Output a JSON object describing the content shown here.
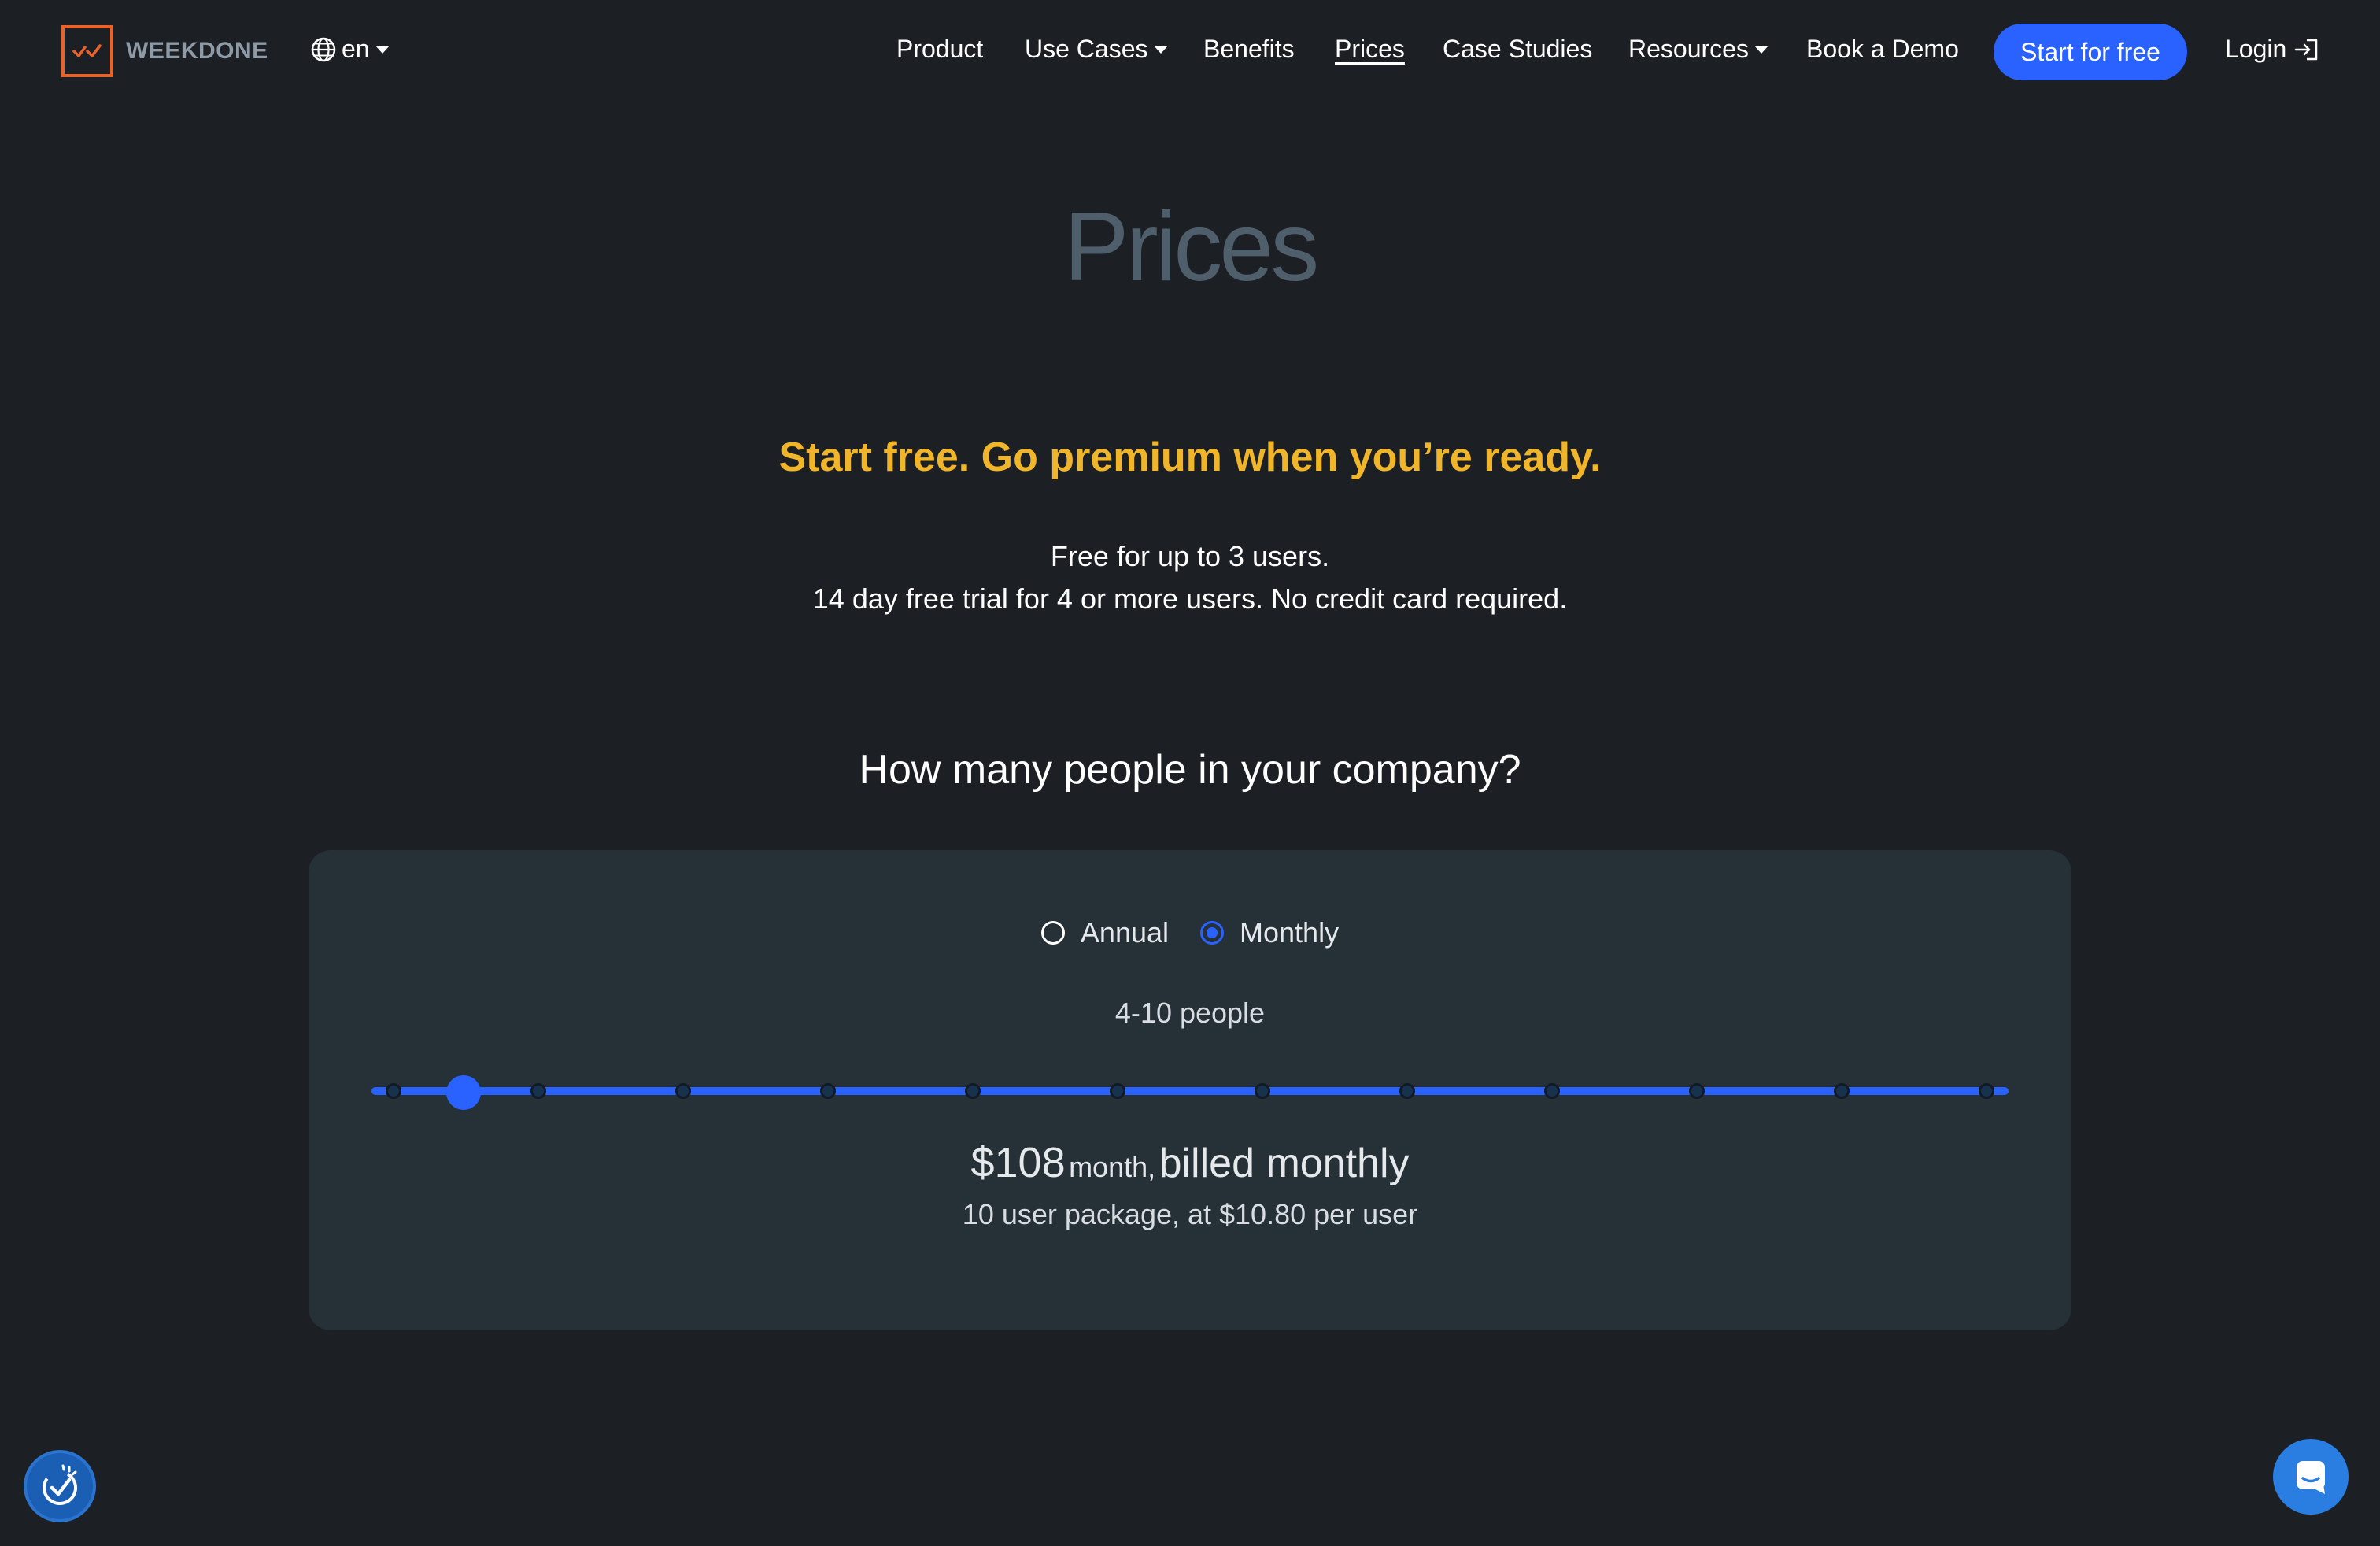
{
  "colors": {
    "background": "#1c2024",
    "card": "#263037",
    "accent": "#2962ff",
    "brand_orange": "#e8622c",
    "headline_yellow": "#f1b52a",
    "title_gray": "#4e5e6b"
  },
  "header": {
    "logo_text": "WEEKDONE",
    "logo_icon": "double-check-icon",
    "language": "en",
    "nav": {
      "product": "Product",
      "use_cases": "Use Cases",
      "benefits": "Benefits",
      "prices": "Prices",
      "case_studies": "Case Studies",
      "resources": "Resources",
      "book_demo": "Book a Demo"
    },
    "cta_label": "Start for free",
    "login_label": "Login"
  },
  "hero": {
    "title": "Prices",
    "subtitle": "Start free. Go premium when you’re ready.",
    "desc_line1": "Free for up to 3 users.",
    "desc_line2": "14 day free trial for 4 or more users. No credit card required.",
    "question": "How many people in your company?"
  },
  "pricing": {
    "billing_options": {
      "annual": "Annual",
      "monthly": "Monthly"
    },
    "selected_billing": "Monthly",
    "range_label": "4-10 people",
    "slider": {
      "stops": 12,
      "selected_position": 0.044
    },
    "price_amount": "$108",
    "price_unit": "month,",
    "price_billing": "billed monthly",
    "price_detail": "10 user package, at $10.80 per user"
  },
  "floating": {
    "accessibility_icon": "accessibility-check-icon",
    "chat_icon": "chat-bubble-icon"
  }
}
